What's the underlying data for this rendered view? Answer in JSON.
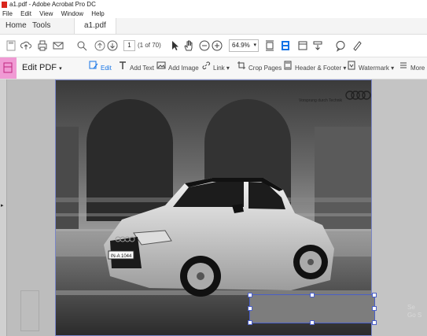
{
  "window": {
    "title": "a1.pdf - Adobe Acrobat Pro DC"
  },
  "menu": [
    "File",
    "Edit",
    "View",
    "Window",
    "Help"
  ],
  "tabs": {
    "home": "Home",
    "tools": "Tools",
    "document": "a1.pdf"
  },
  "nav": {
    "page_current": "1",
    "page_total": "(1 of 70)",
    "zoom": "64.9%"
  },
  "edit_panel": {
    "title": "Edit PDF",
    "tools": [
      {
        "label": "Edit",
        "icon": "edit-icon"
      },
      {
        "label": "Add Text",
        "icon": "add-text-icon"
      },
      {
        "label": "Add Image",
        "icon": "add-image-icon"
      },
      {
        "label": "Link",
        "icon": "link-icon"
      },
      {
        "label": "Crop Pages",
        "icon": "crop-icon"
      },
      {
        "label": "Header & Footer",
        "icon": "header-footer-icon"
      },
      {
        "label": "Watermark",
        "icon": "watermark-icon"
      },
      {
        "label": "More",
        "icon": "more-icon"
      }
    ]
  },
  "document": {
    "tagline": "Vorsprung durch Technik",
    "plate": "IN-A 1044"
  },
  "watermark_partial": [
    "Se",
    "Go S"
  ],
  "colors": {
    "accent": "#1473e6",
    "edit_pink": "#f09ad4",
    "selection": "#4a5fc8"
  }
}
